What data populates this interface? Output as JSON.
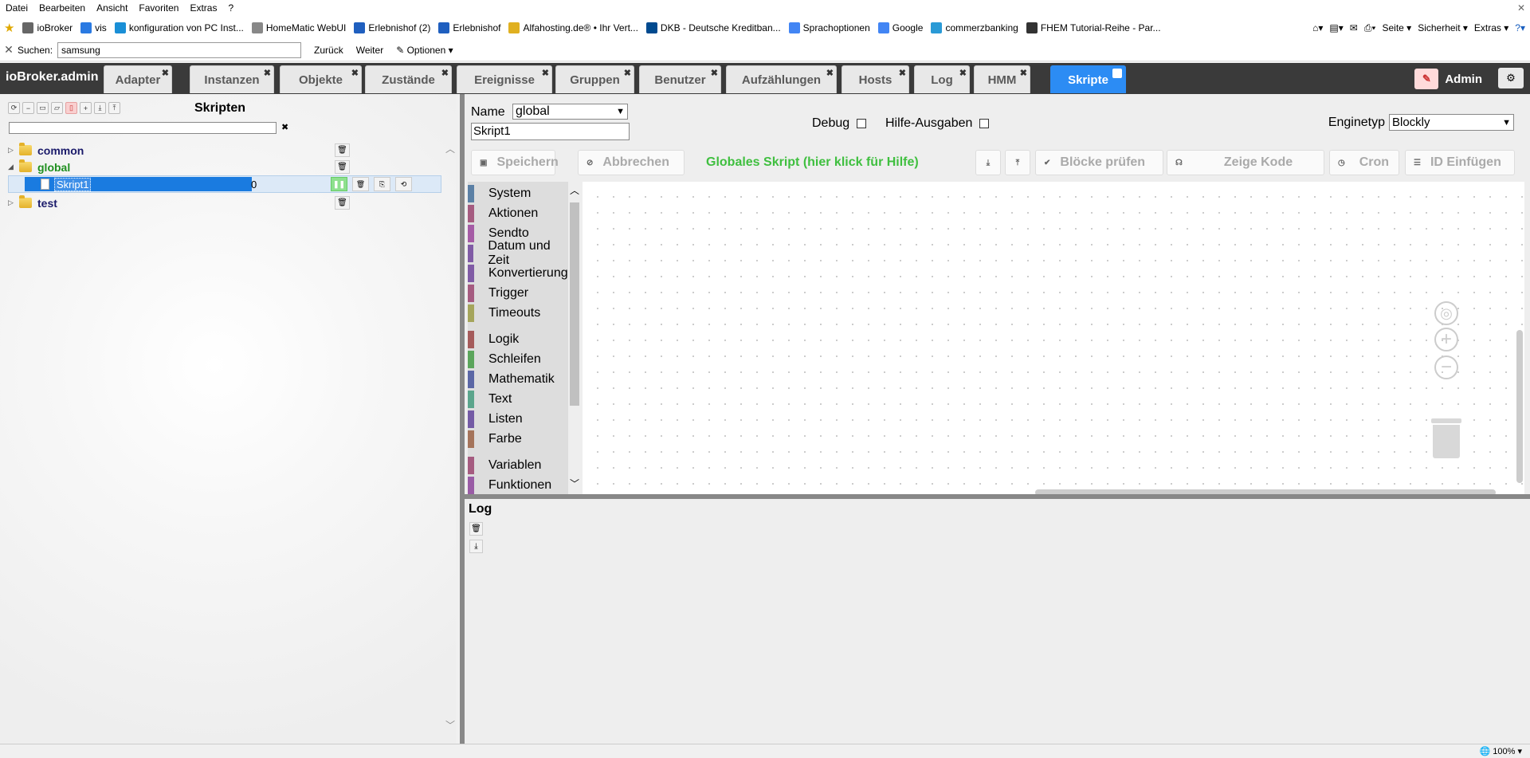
{
  "browser": {
    "menu": [
      "Datei",
      "Bearbeiten",
      "Ansicht",
      "Favoriten",
      "Extras",
      "?"
    ],
    "favorites": [
      {
        "label": "ioBroker",
        "color": "#666666"
      },
      {
        "label": "vis",
        "color": "#2a7ae2"
      },
      {
        "label": "konfiguration von PC Inst...",
        "color": "#1a8fd6"
      },
      {
        "label": "HomeMatic WebUI",
        "color": "#888888"
      },
      {
        "label": "Erlebnishof (2)",
        "color": "#1f5fbf"
      },
      {
        "label": "Erlebnishof",
        "color": "#1f5fbf"
      },
      {
        "label": "Alfahosting.de® • Ihr Vert...",
        "color": "#e0b020"
      },
      {
        "label": "DKB - Deutsche Kreditban...",
        "color": "#004a8f"
      },
      {
        "label": "Sprachoptionen",
        "color": "#4285f4"
      },
      {
        "label": "Google",
        "color": "#4285f4"
      },
      {
        "label": "commerzbanking",
        "color": "#2a9ad6"
      },
      {
        "label": "FHEM Tutorial-Reihe - Par...",
        "color": "#333333"
      }
    ],
    "command_bar": [
      "Seite",
      "Sicherheit",
      "Extras"
    ],
    "find": {
      "label": "Suchen:",
      "value": "samsung",
      "back": "Zurück",
      "forward": "Weiter",
      "options": "Optionen"
    },
    "zoom": "100%"
  },
  "app": {
    "brand": "ioBroker.admin",
    "tabs": [
      {
        "label": "Adapter"
      },
      {
        "label": "Instanzen"
      },
      {
        "label": "Objekte"
      },
      {
        "label": "Zustände"
      },
      {
        "label": "Ereignisse"
      },
      {
        "label": "Gruppen"
      },
      {
        "label": "Benutzer"
      },
      {
        "label": "Aufzählungen"
      },
      {
        "label": "Hosts"
      },
      {
        "label": "Log"
      },
      {
        "label": "HMM"
      },
      {
        "label": "Skripte"
      }
    ],
    "active_tab": "Skripte",
    "admin_label": "Admin"
  },
  "scripts_panel": {
    "title": "Skripten",
    "filter_value": "",
    "tree": [
      {
        "name": "common",
        "expanded": false
      },
      {
        "name": "global",
        "expanded": true
      },
      {
        "name": "test",
        "expanded": false
      }
    ],
    "selected_script": {
      "name": "Skript1",
      "value": "0"
    }
  },
  "editor": {
    "name_label": "Name",
    "folder_select": "global",
    "script_name": "Skript1",
    "debug_label": "Debug",
    "hilfe_label": "Hilfe-Ausgaben",
    "engine_label": "Enginetyp",
    "engine_value": "Blockly",
    "buttons": {
      "save": "Speichern",
      "cancel": "Abbrechen",
      "check": "Blöcke prüfen",
      "show_code": "Zeige Kode",
      "cron": "Cron",
      "insert_id": "ID Einfügen"
    },
    "global_info": "Globales Skript (hier klick für Hilfe)",
    "categories": [
      {
        "label": "System",
        "color": "#5b80a5"
      },
      {
        "label": "Aktionen",
        "color": "#a55b80"
      },
      {
        "label": "Sendto",
        "color": "#a55ba5"
      },
      {
        "label": "Datum und Zeit",
        "color": "#805ba5"
      },
      {
        "label": "Konvertierung",
        "color": "#805ba5"
      },
      {
        "label": "Trigger",
        "color": "#a55b80"
      },
      {
        "label": "Timeouts",
        "color": "#a5a55b"
      },
      {
        "label": "Logik",
        "color": "#a55b5b"
      },
      {
        "label": "Schleifen",
        "color": "#5ba55b"
      },
      {
        "label": "Mathematik",
        "color": "#5b67a5"
      },
      {
        "label": "Text",
        "color": "#5ba58c"
      },
      {
        "label": "Listen",
        "color": "#745ba5"
      },
      {
        "label": "Farbe",
        "color": "#a5745b"
      },
      {
        "label": "Variablen",
        "color": "#a55b80"
      },
      {
        "label": "Funktionen",
        "color": "#995ba5"
      }
    ]
  },
  "log_panel": {
    "title": "Log"
  }
}
